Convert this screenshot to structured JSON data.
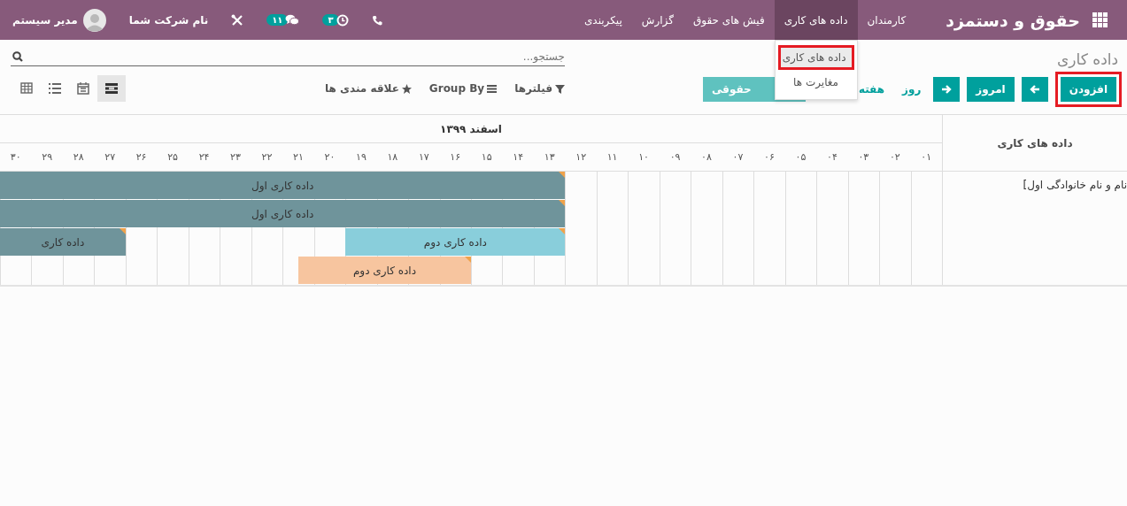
{
  "navbar": {
    "brand": "حقوق و دستمزد",
    "menu": [
      {
        "label": "کارمندان",
        "selected": false
      },
      {
        "label": "داده های کاری",
        "selected": true
      },
      {
        "label": "فیش های حقوق",
        "selected": false
      },
      {
        "label": "گزارش",
        "selected": false
      },
      {
        "label": "پیکربندی",
        "selected": false
      }
    ],
    "clock_count": "۳",
    "messages_count": "۱۱",
    "company": "نام شرکت شما",
    "user": "مدیر سیستم"
  },
  "dropdown": {
    "items": [
      {
        "label": "داده های کاری",
        "selected": true,
        "outlined": true
      },
      {
        "label": "مغایرت ها",
        "selected": false,
        "outlined": false
      }
    ]
  },
  "breadcrumb": "داده کاری",
  "search": {
    "placeholder": "جستجو..."
  },
  "actions": [
    {
      "kind": "create",
      "label": "افزودن",
      "outlined": true
    },
    {
      "kind": "next"
    },
    {
      "kind": "today",
      "label": "امروز"
    },
    {
      "kind": "prev"
    }
  ],
  "scales": [
    {
      "label": "روز"
    },
    {
      "label": "هفته"
    }
  ],
  "extra_button": {
    "label": "حقوقی"
  },
  "filters": [
    {
      "kind": "filter",
      "label": "فیلترها"
    },
    {
      "kind": "groupby",
      "label": "Group By"
    },
    {
      "kind": "favorite",
      "label": "علاقه مندی ها"
    }
  ],
  "views": [
    {
      "kind": "gantt",
      "selected": true
    },
    {
      "kind": "calendar",
      "selected": false
    },
    {
      "kind": "list",
      "selected": false
    },
    {
      "kind": "pivot",
      "selected": false
    }
  ],
  "gantt": {
    "header": "داده های کاری",
    "period": "اسفند ۱۳۹۹",
    "days": [
      "۰۱",
      "۰۲",
      "۰۳",
      "۰۴",
      "۰۵",
      "۰۶",
      "۰۷",
      "۰۸",
      "۰۹",
      "۱۰",
      "۱۱",
      "۱۲",
      "۱۳",
      "۱۴",
      "۱۵",
      "۱۶",
      "۱۷",
      "۱۸",
      "۱۹",
      "۲۰",
      "۲۱",
      "۲۲",
      "۲۳",
      "۲۴",
      "۲۵",
      "۲۶",
      "۲۷",
      "۲۸",
      "۲۹",
      "۳۰"
    ],
    "groups": [
      {
        "label": "نام و نام خانوادگی اول]",
        "rows": [
          [
            {
              "label": "داده کاری اول",
              "color": "#6f949b"
            }
          ],
          [
            {
              "label": "داده کاری اول",
              "color": "#6f949b"
            }
          ],
          [
            {
              "label": "داده کاری دوم",
              "color": "#89cedb"
            },
            {
              "label": "داده کاری",
              "color": "#6f949b"
            }
          ],
          [
            {
              "label": "داده کاری دوم",
              "color": "#f7c59f"
            }
          ]
        ]
      }
    ]
  }
}
